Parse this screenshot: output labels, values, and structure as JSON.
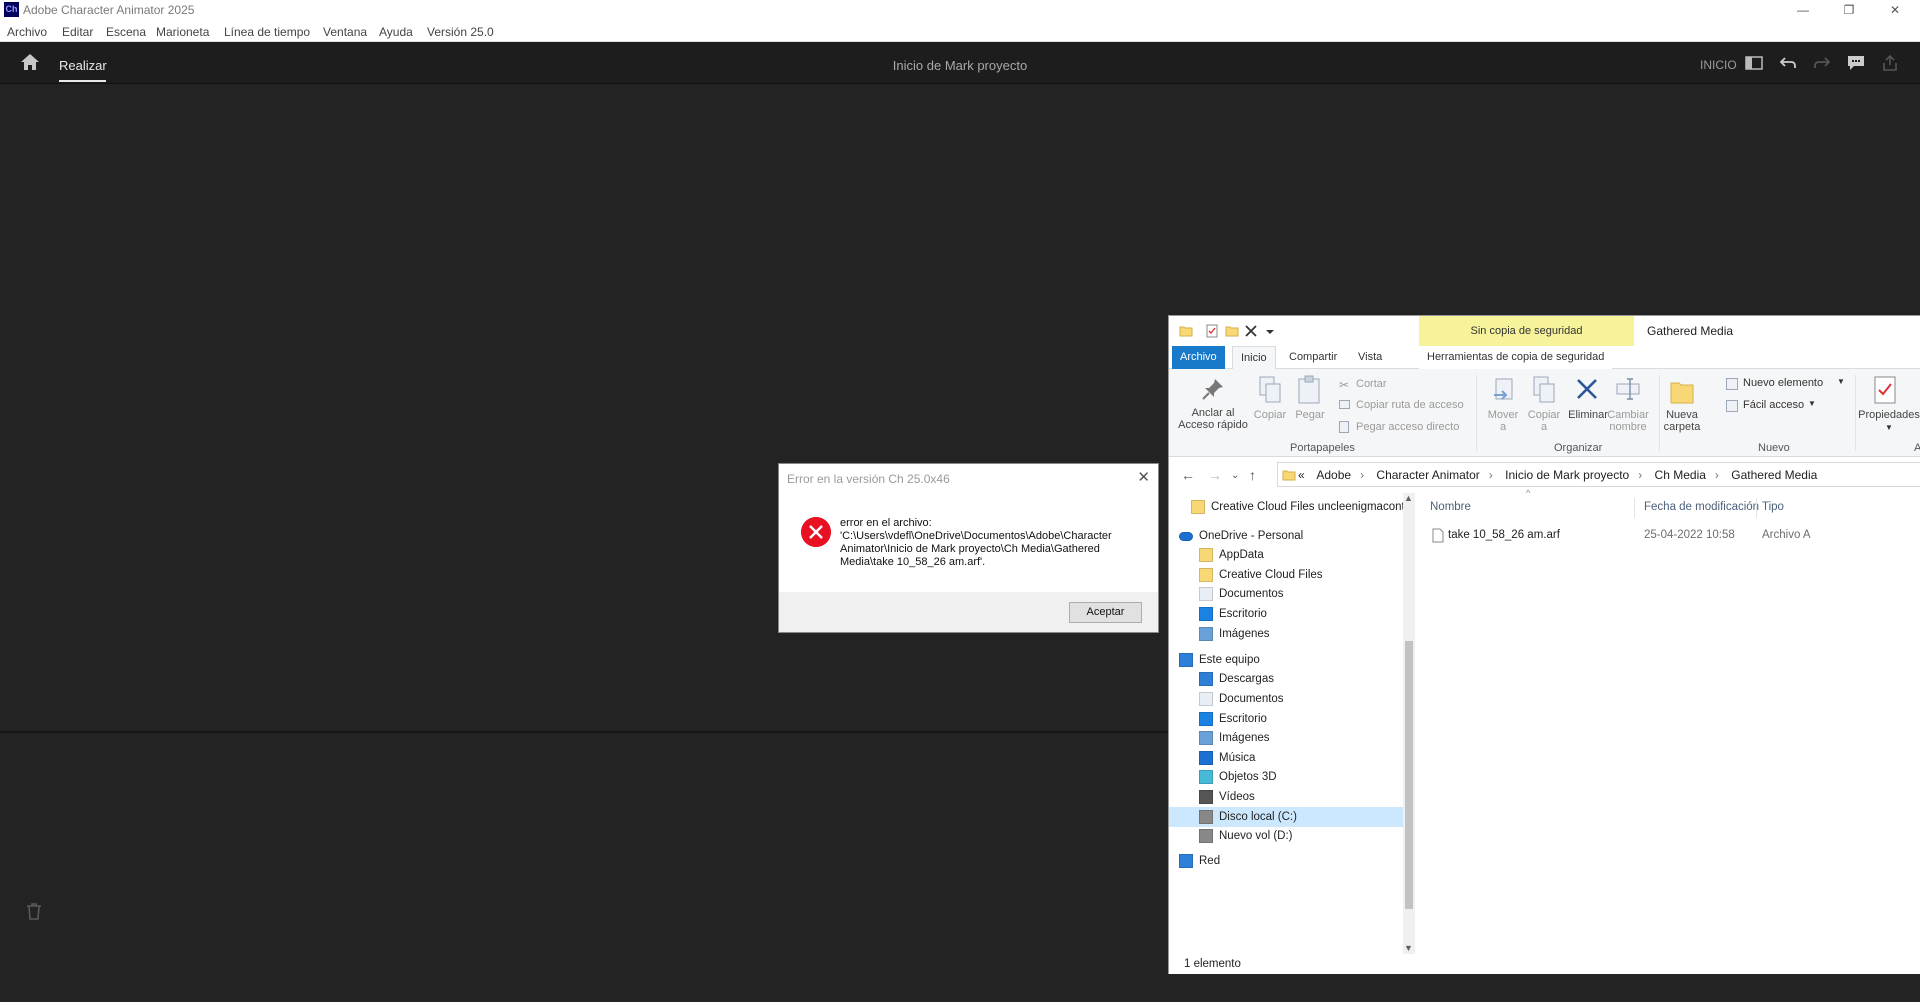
{
  "app": {
    "title": "Adobe Character Animator 2025",
    "logo_text": "Ch",
    "window_controls": [
      "—",
      "❐",
      "✕"
    ]
  },
  "menu": [
    "Archivo",
    "Editar",
    "Escena",
    "Marioneta",
    "Línea de tiempo",
    "Ventana",
    "Ayuda",
    "Versión 25.0"
  ],
  "toolbar": {
    "tab": "Realizar",
    "project_title": "Inicio de Mark proyecto",
    "workspace": "INICIO"
  },
  "dialog": {
    "title": "Error en la versión Ch 25.0x46",
    "message": "error en el archivo:\n'C:\\Users\\vdefl\\OneDrive\\Documentos\\Adobe\\Character Animator\\Inicio de Mark proyecto\\Ch Media\\Gathered Media\\take 10_58_26 am.arf'.",
    "button": "Aceptar",
    "close": "✕"
  },
  "explorer": {
    "window_title": "Gathered Media",
    "context_tab_title": "Sin copia de seguridad",
    "tabs": [
      "Archivo",
      "Inicio",
      "Compartir",
      "Vista",
      "Herramientas de copia de seguridad"
    ],
    "ribbon": {
      "pin": "Anclar al\nAcceso rápido",
      "copy": "Copiar",
      "paste": "Pegar",
      "cut": "Cortar",
      "copy_path": "Copiar ruta de acceso",
      "paste_shortcut": "Pegar acceso directo",
      "group_clipboard": "Portapapeles",
      "move_to": "Mover\na",
      "copy_to": "Copiar\na",
      "delete": "Eliminar",
      "rename": "Cambiar\nnombre",
      "group_organize": "Organizar",
      "new_folder": "Nueva\ncarpeta",
      "new_item": "Nuevo elemento",
      "easy_access": "Fácil acceso",
      "group_new": "Nuevo",
      "properties": "Propiedades",
      "group_open_cut": "A"
    },
    "breadcrumb": [
      "«",
      "Adobe",
      "Character Animator",
      "Inicio de Mark proyecto",
      "Ch Media",
      "Gathered Media"
    ],
    "nav_items": [
      {
        "label": "Creative Cloud Files  uncleenigmaconte",
        "icon": "folder-icon"
      },
      {
        "label": "OneDrive - Personal",
        "icon": "onedrive-icon"
      },
      {
        "label": "AppData",
        "icon": "folder-icon"
      },
      {
        "label": "Creative Cloud Files",
        "icon": "folder-icon"
      },
      {
        "label": "Documentos",
        "icon": "documents-icon"
      },
      {
        "label": "Escritorio",
        "icon": "desktop-icon"
      },
      {
        "label": "Imágenes",
        "icon": "pictures-icon"
      },
      {
        "label": "Este equipo",
        "icon": "computer-icon"
      },
      {
        "label": "Descargas",
        "icon": "downloads-icon"
      },
      {
        "label": "Documentos",
        "icon": "documents-icon"
      },
      {
        "label": "Escritorio",
        "icon": "desktop-icon"
      },
      {
        "label": "Imágenes",
        "icon": "pictures-icon"
      },
      {
        "label": "Música",
        "icon": "music-icon"
      },
      {
        "label": "Objetos 3D",
        "icon": "3d-objects-icon"
      },
      {
        "label": "Vídeos",
        "icon": "videos-icon"
      },
      {
        "label": "Disco local (C:)",
        "icon": "drive-icon"
      },
      {
        "label": "Nuevo vol (D:)",
        "icon": "drive-icon"
      },
      {
        "label": "Red",
        "icon": "network-icon"
      }
    ],
    "columns": [
      "Nombre",
      "Fecha de modificación",
      "Tipo"
    ],
    "files": [
      {
        "name": "take 10_58_26 am.arf",
        "modified": "25-04-2022 10:58",
        "type": "Archivo A"
      }
    ],
    "status": "1 elemento"
  }
}
